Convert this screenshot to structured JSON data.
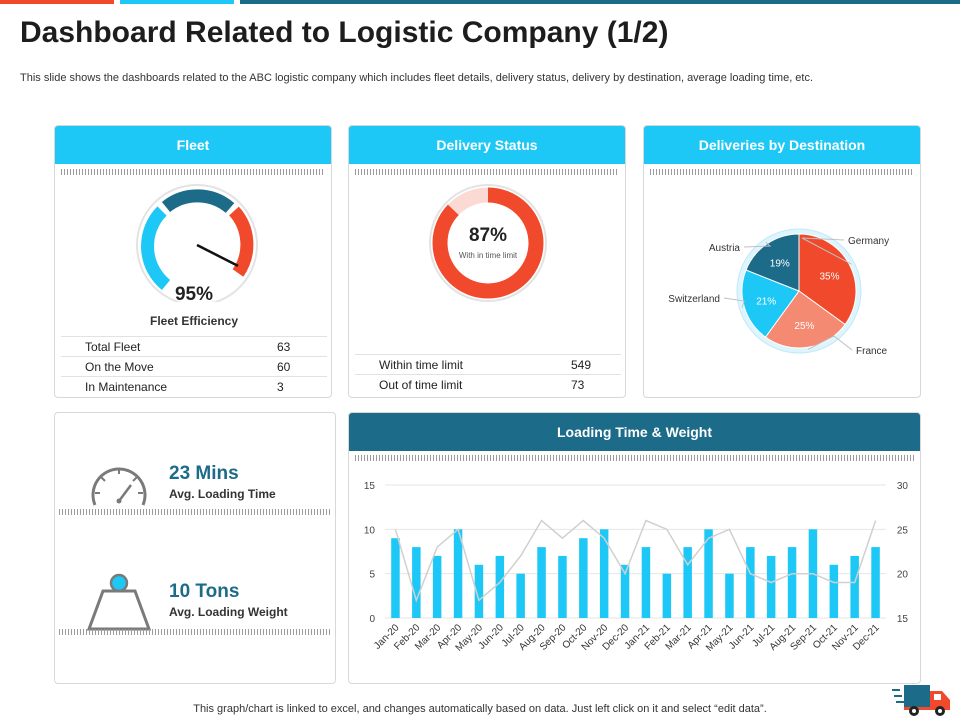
{
  "title": "Dashboard Related to Logistic Company (1/2)",
  "subtitle": "This slide shows the dashboards related to the ABC logistic company which includes fleet details, delivery status, delivery by destination, average loading time, etc.",
  "footnote": "This graph/chart is linked to excel, and changes automatically based on data. Just left click on it and select “edit data”.",
  "colors": {
    "cyan": "#1ec8f6",
    "dark_teal": "#1c6b88",
    "orange": "#f0492b",
    "salmon": "#f58a72",
    "light_pink": "#fbdad4"
  },
  "fleet": {
    "header": "Fleet",
    "gauge_value": "95%",
    "gauge_label": "Fleet Efficiency",
    "gauge_fraction": 0.95,
    "rows": [
      {
        "label": "Total Fleet",
        "value": "63"
      },
      {
        "label": "On the Move",
        "value": "60"
      },
      {
        "label": "In Maintenance",
        "value": "3"
      }
    ]
  },
  "delivery_status": {
    "header": "Delivery Status",
    "percent": "87%",
    "percent_fraction": 0.87,
    "caption": "With in time limit",
    "rows": [
      {
        "label": "Within time limit",
        "value": "549"
      },
      {
        "label": "Out of time limit",
        "value": "73"
      }
    ]
  },
  "loading_kpis": {
    "time_value": "23 Mins",
    "time_label": "Avg. Loading Time",
    "weight_value": "10 Tons",
    "weight_label": "Avg. Loading Weight",
    "time_icon": "speedometer-icon",
    "weight_icon": "weight-icon"
  },
  "delivery_truck_icon": "delivery-truck-icon",
  "chart_data": [
    {
      "type": "pie",
      "title": "Deliveries by Destination",
      "slices": [
        {
          "label": "Germany",
          "value": 35,
          "display": "35%",
          "color": "#f0492b"
        },
        {
          "label": "France",
          "value": 25,
          "display": "25%",
          "color": "#f58a72"
        },
        {
          "label": "Switzerland",
          "value": 21,
          "display": "21%",
          "color": "#1ec8f6"
        },
        {
          "label": "Austria",
          "value": 19,
          "display": "19%",
          "color": "#1c6b88"
        }
      ]
    },
    {
      "type": "bar",
      "title": "Loading Time & Weight",
      "categories": [
        "Jan-20",
        "Feb-20",
        "Mar-20",
        "Apr-20",
        "May-20",
        "Jun-20",
        "Jul-20",
        "Aug-20",
        "Sep-20",
        "Oct-20",
        "Nov-20",
        "Dec-20",
        "Jan-21",
        "Feb-21",
        "Mar-21",
        "Apr-21",
        "May-21",
        "Jun-21",
        "Jul-21",
        "Aug-21",
        "Sep-21",
        "Oct-21",
        "Nov-21",
        "Dec-21"
      ],
      "series": [
        {
          "values": [
            9,
            8,
            7,
            10,
            6,
            7,
            5,
            8,
            7,
            9,
            10,
            6,
            8,
            5,
            8,
            10,
            5,
            8,
            7,
            8,
            10,
            6,
            7,
            8
          ],
          "axis": "left",
          "color": "#1ec8f6"
        },
        {
          "values": [
            25,
            17,
            23,
            25,
            17,
            19,
            22,
            26,
            24,
            26,
            24,
            20,
            26,
            25,
            21,
            24,
            25,
            20,
            19,
            20,
            20,
            19,
            19,
            26
          ],
          "axis": "right",
          "color": "#d0d0d0"
        }
      ],
      "ylim": [
        0,
        15
      ],
      "yticks": [
        0,
        5,
        10,
        15
      ],
      "y2lim": [
        15,
        30
      ],
      "y2ticks": [
        15,
        20,
        25,
        30
      ],
      "grid": true
    }
  ]
}
